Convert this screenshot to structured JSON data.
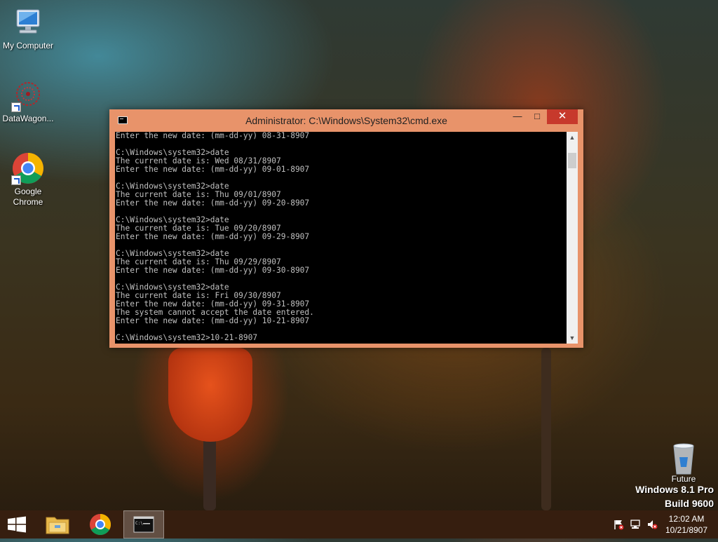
{
  "desktop": {
    "icons": [
      {
        "label": "My Computer"
      },
      {
        "label": "DataWagon..."
      },
      {
        "label": "Google Chrome"
      },
      {
        "label": "Future"
      }
    ],
    "watermark": {
      "edition": "Windows 8.1 Pro",
      "build": "Build 9600"
    }
  },
  "window": {
    "title": "Administrator: C:\\Windows\\System32\\cmd.exe",
    "minimize_label": "—",
    "maximize_label": "□",
    "close_label": "✕",
    "lines": [
      "Enter the new date: (mm-dd-yy) 08-31-8907",
      "",
      "C:\\Windows\\system32>date",
      "The current date is: Wed 08/31/8907",
      "Enter the new date: (mm-dd-yy) 09-01-8907",
      "",
      "C:\\Windows\\system32>date",
      "The current date is: Thu 09/01/8907",
      "Enter the new date: (mm-dd-yy) 09-20-8907",
      "",
      "C:\\Windows\\system32>date",
      "The current date is: Tue 09/20/8907",
      "Enter the new date: (mm-dd-yy) 09-29-8907",
      "",
      "C:\\Windows\\system32>date",
      "The current date is: Thu 09/29/8907",
      "Enter the new date: (mm-dd-yy) 09-30-8907",
      "",
      "C:\\Windows\\system32>date",
      "The current date is: Fri 09/30/8907",
      "Enter the new date: (mm-dd-yy) 09-31-8907",
      "The system cannot accept the date entered.",
      "Enter the new date: (mm-dd-yy) 10-21-8907",
      "",
      "C:\\Windows\\system32>10-21-8907"
    ]
  },
  "taskbar": {
    "clock_time": "12:02 AM",
    "clock_date": "10/21/8907"
  },
  "icons": {
    "start": "windows-logo-icon",
    "explorer": "folder-icon",
    "chrome": "chrome-icon",
    "cmd": "cmd-icon"
  },
  "colors": {
    "titlebar": "#e8936a",
    "close_button": "#c7392c",
    "console_bg": "#000000",
    "console_text": "#c0c0c0"
  }
}
